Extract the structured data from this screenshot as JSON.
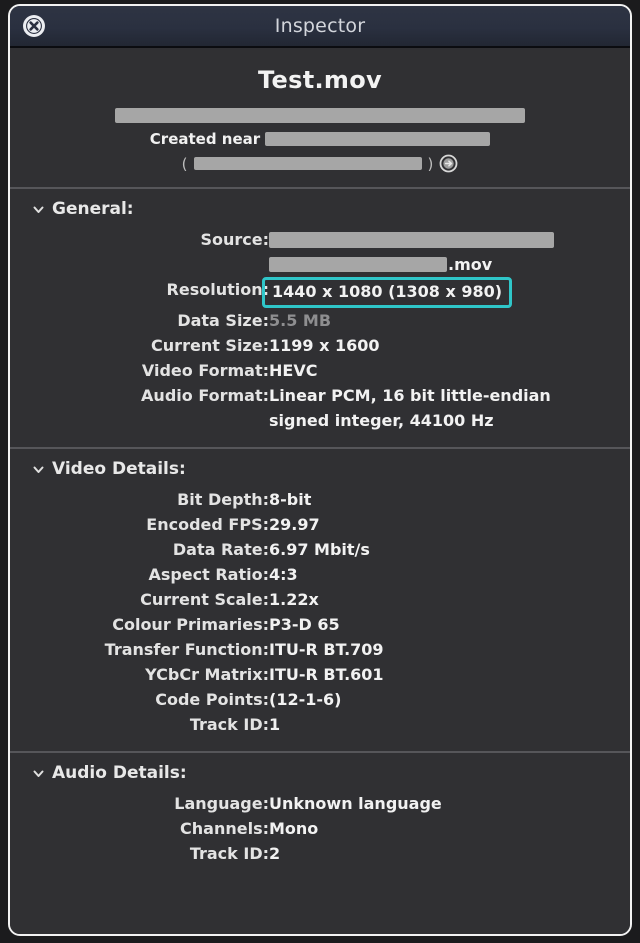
{
  "window": {
    "title": "Inspector",
    "close_icon": "close-circle-icon"
  },
  "header": {
    "filename": "Test.mov",
    "path_redacted": "",
    "created_near_label": "Created near",
    "location_redacted": "",
    "paren_open": "(",
    "coords_redacted": "",
    "paren_close": ")",
    "reveal_icon": "arrow-right-circle-icon"
  },
  "colors": {
    "highlight": "#2fc6c9",
    "titlebar": "#2a3040",
    "panel": "#303033",
    "redaction": "#a6a6a6"
  },
  "sections": [
    {
      "id": "general",
      "title": "General:",
      "chevron": "chevron-down-icon",
      "rows": [
        {
          "label": "Source:",
          "value": "",
          "type": "redacted-source",
          "ext": ".mov"
        },
        {
          "label": "Resolution:",
          "value": "1440 x 1080 (1308 x 980)",
          "type": "highlighted"
        },
        {
          "label": "Data Size:",
          "value": "5.5 MB",
          "type": "dim"
        },
        {
          "label": "Current Size:",
          "value": "1199 x 1600",
          "type": "text"
        },
        {
          "label": "Video Format:",
          "value": "HEVC",
          "type": "text"
        },
        {
          "label": "Audio Format:",
          "value": "Linear PCM, 16 bit little-endian signed integer, 44100 Hz",
          "type": "wrap"
        }
      ]
    },
    {
      "id": "video-details",
      "title": "Video Details:",
      "chevron": "chevron-down-icon",
      "rows": [
        {
          "label": "Bit Depth:",
          "value": "8-bit",
          "type": "text"
        },
        {
          "label": "Encoded FPS:",
          "value": "29.97",
          "type": "text"
        },
        {
          "label": "Data Rate:",
          "value": "6.97 Mbit/s",
          "type": "text"
        },
        {
          "label": "Aspect Ratio:",
          "value": "4:3",
          "type": "text"
        },
        {
          "label": "Current Scale:",
          "value": "1.22x",
          "type": "text"
        },
        {
          "label": "Colour Primaries:",
          "value": "P3-D 65",
          "type": "text"
        },
        {
          "label": "Transfer Function:",
          "value": "ITU-R BT.709",
          "type": "text"
        },
        {
          "label": "YCbCr Matrix:",
          "value": "ITU-R BT.601",
          "type": "text"
        },
        {
          "label": "Code Points:",
          "value": "(12-1-6)",
          "type": "text"
        },
        {
          "label": "Track ID:",
          "value": "1",
          "type": "text"
        }
      ]
    },
    {
      "id": "audio-details",
      "title": "Audio Details:",
      "chevron": "chevron-down-icon",
      "rows": [
        {
          "label": "Language:",
          "value": "Unknown language",
          "type": "text"
        },
        {
          "label": "Channels:",
          "value": "Mono",
          "type": "text"
        },
        {
          "label": "Track ID:",
          "value": "2",
          "type": "text"
        }
      ]
    }
  ]
}
